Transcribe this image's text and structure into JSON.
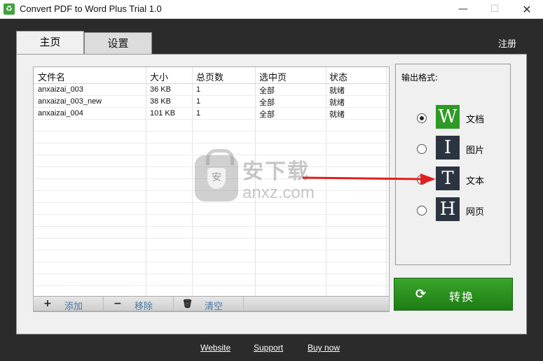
{
  "window": {
    "title": "Convert PDF to Word Plus Trial 1.0",
    "icon_glyph": "♻",
    "min_glyph": "—",
    "max_glyph": "☐",
    "close_glyph": "✕"
  },
  "tabs": [
    {
      "label": "主页",
      "active": true
    },
    {
      "label": "设置",
      "active": false
    }
  ],
  "register_label": "注册",
  "table": {
    "headers": [
      "文件名",
      "大小",
      "总页数",
      "选中页",
      "状态"
    ],
    "rows": [
      {
        "name": "anxaizai_003",
        "size": "36 KB",
        "pages": "1",
        "selected": "全部",
        "status": "就绪"
      },
      {
        "name": "anxaizai_003_new",
        "size": "38 KB",
        "pages": "1",
        "selected": "全部",
        "status": "就绪"
      },
      {
        "name": "anxaizai_004",
        "size": "101 KB",
        "pages": "1",
        "selected": "全部",
        "status": "就绪"
      }
    ]
  },
  "toolbar": {
    "add": {
      "icon": "+",
      "label": "添加"
    },
    "remove": {
      "icon": "−",
      "label": "移除"
    },
    "clear": {
      "icon": "🗑",
      "label": "清空"
    }
  },
  "output": {
    "title": "输出格式:",
    "formats": [
      {
        "letter": "W",
        "label": "文档",
        "color": "#2e9a26",
        "checked": true
      },
      {
        "letter": "I",
        "label": "图片",
        "color": "#2b3440",
        "checked": false
      },
      {
        "letter": "T",
        "label": "文本",
        "color": "#2b3440",
        "checked": false
      },
      {
        "letter": "H",
        "label": "网页",
        "color": "#2b3440",
        "checked": false
      }
    ]
  },
  "convert": {
    "icon": "⟳",
    "label": "转换"
  },
  "footer": {
    "links": [
      "Website",
      "Support",
      "Buy now"
    ]
  },
  "watermark": {
    "shield_glyph": "安",
    "title": "安下载",
    "subtitle": "anxz.com"
  },
  "colors": {
    "accent_green": "#2e9a26",
    "dark_bg": "#2b2b2b",
    "link_blue": "#4a7aa8"
  }
}
